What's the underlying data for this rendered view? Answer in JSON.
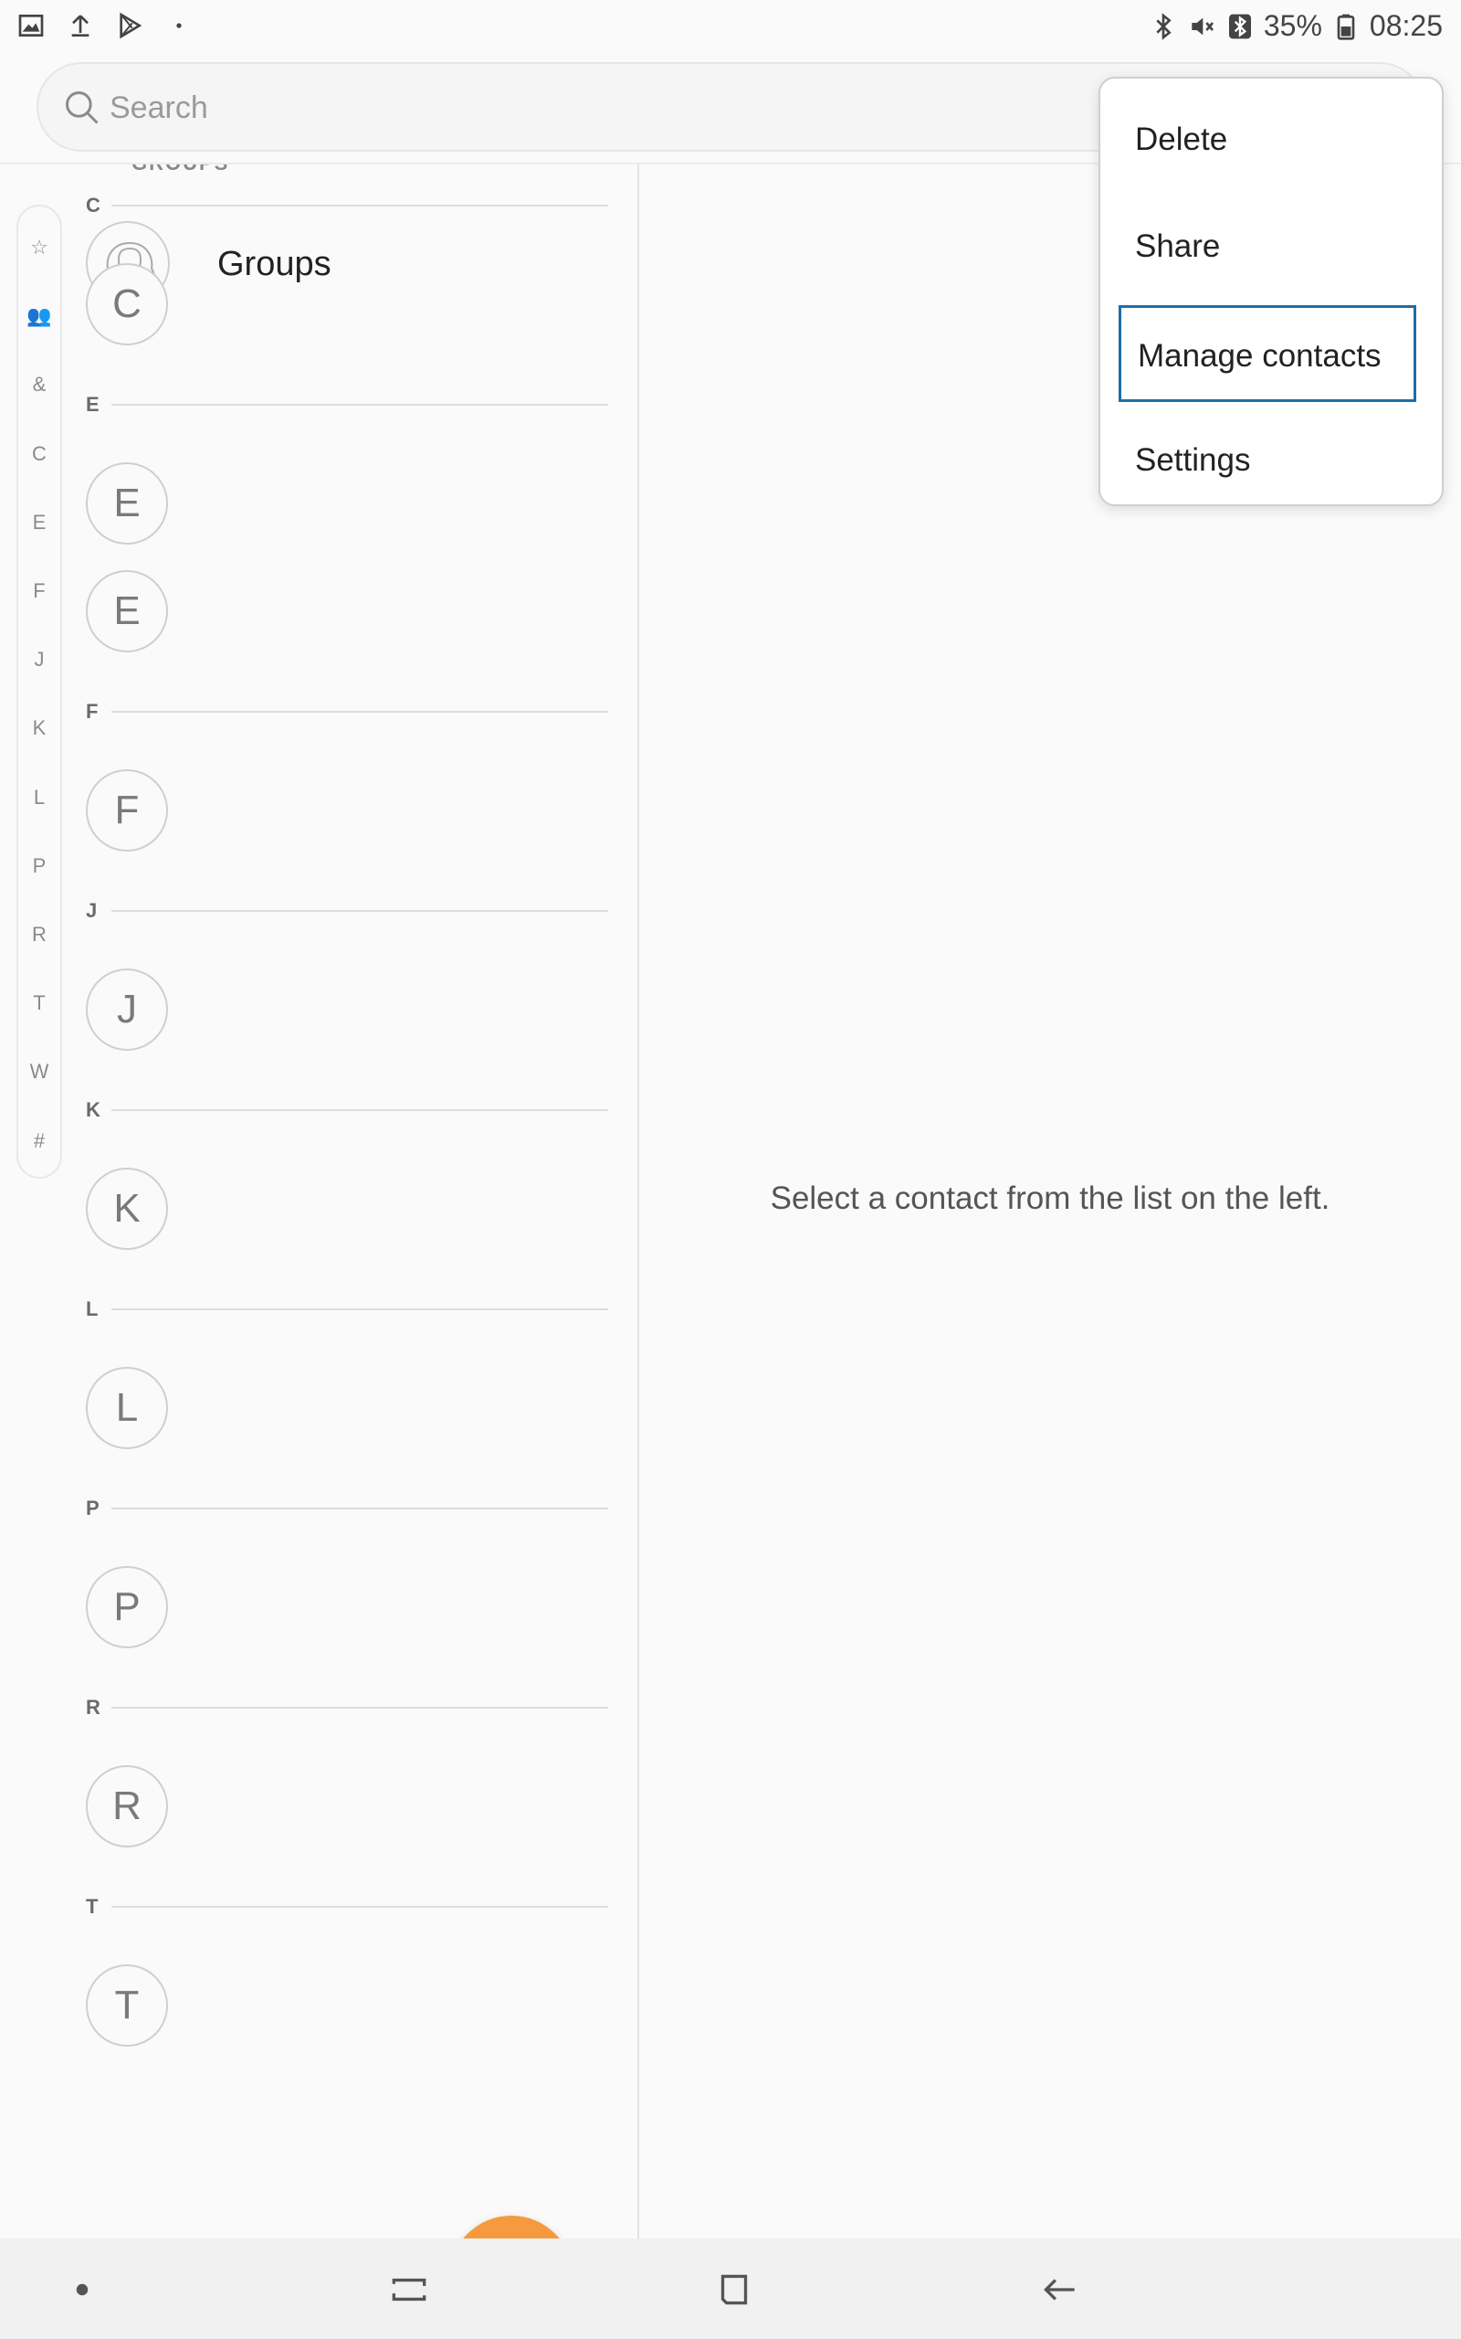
{
  "status_bar": {
    "battery": "35%",
    "time": "08:25",
    "left_icons": [
      "gallery-icon",
      "upload-icon",
      "play-store-icon",
      "dot-icon"
    ],
    "right_icons": [
      "bluetooth-icon",
      "mute-icon",
      "bluetooth-connected-icon",
      "battery-icon"
    ]
  },
  "search": {
    "placeholder": "Search"
  },
  "index_bar": {
    "items": [
      "☆",
      "👥",
      "&",
      "C",
      "E",
      "F",
      "J",
      "K",
      "L",
      "P",
      "R",
      "T",
      "W",
      "#"
    ]
  },
  "contacts": {
    "groups_label": "GROUPS",
    "groups_item": "Groups",
    "sections": [
      {
        "letter": "C",
        "avatars": [
          "C"
        ]
      },
      {
        "letter": "E",
        "avatars": [
          "E",
          "E"
        ]
      },
      {
        "letter": "F",
        "avatars": [
          "F"
        ]
      },
      {
        "letter": "J",
        "avatars": [
          "J"
        ]
      },
      {
        "letter": "K",
        "avatars": [
          "K"
        ]
      },
      {
        "letter": "L",
        "avatars": [
          "L"
        ]
      },
      {
        "letter": "P",
        "avatars": [
          "P"
        ]
      },
      {
        "letter": "R",
        "avatars": [
          "R"
        ]
      },
      {
        "letter": "T",
        "avatars": [
          "T"
        ]
      }
    ]
  },
  "detail": {
    "empty_message": "Select a contact from the list on the left."
  },
  "menu": {
    "items": [
      "Delete",
      "Share",
      "Manage contacts",
      "Settings"
    ],
    "focused": "Manage contacts"
  },
  "colors": {
    "fab": "#f59a3e",
    "focus": "#1d6ea8",
    "background": "#fafafa"
  },
  "navigation": {
    "buttons": [
      "home-dot-icon",
      "recents-icon",
      "overview-icon",
      "back-icon"
    ]
  }
}
